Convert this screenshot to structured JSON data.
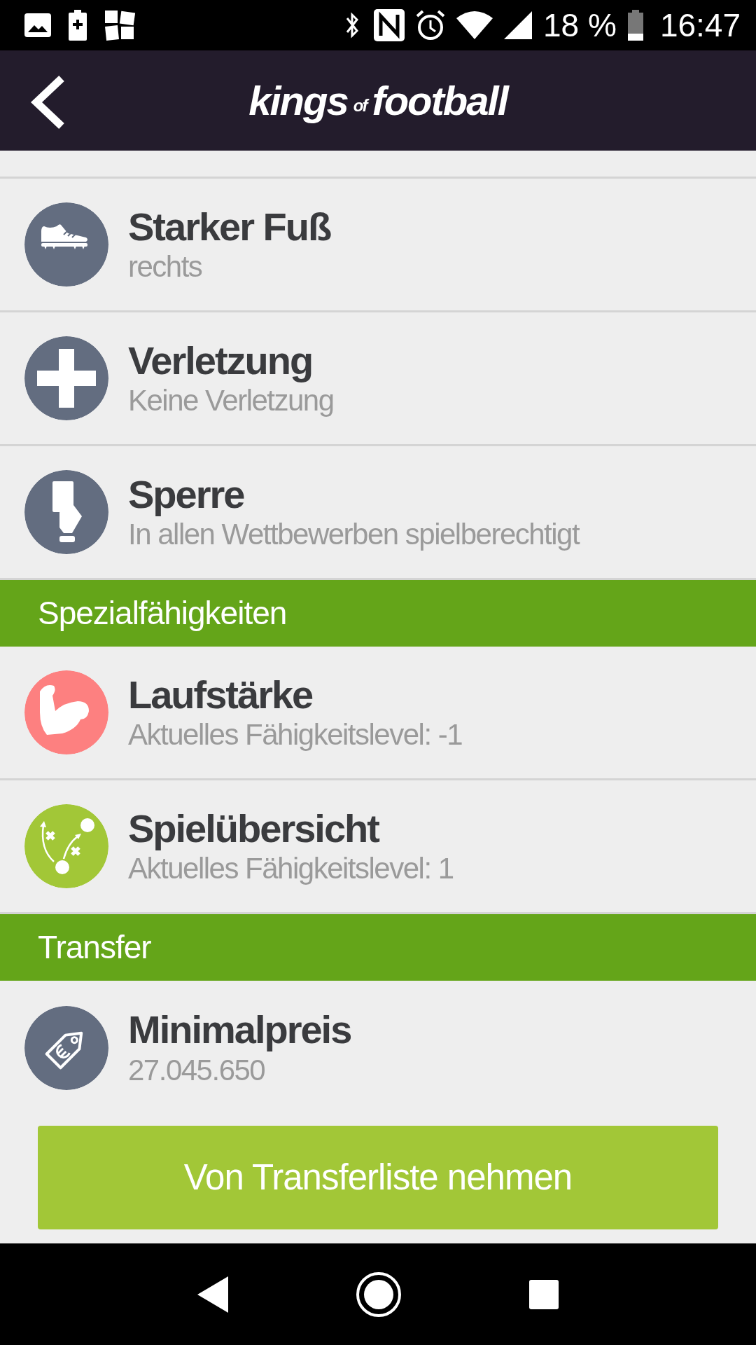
{
  "status_bar": {
    "battery_percent": "18 %",
    "time": "16:47"
  },
  "header": {
    "logo": [
      "kings",
      "of",
      "football"
    ]
  },
  "sections": [
    {
      "items": [
        {
          "kind": "boot",
          "color": "#636d80",
          "title": "Starker Fuß",
          "subtitle": "rechts"
        },
        {
          "kind": "cross",
          "color": "#636d80",
          "title": "Verletzung",
          "subtitle": "Keine Verletzung"
        },
        {
          "kind": "card",
          "color": "#636d80",
          "title": "Sperre",
          "subtitle": "In allen Wettbewerben spielberechtigt"
        }
      ]
    },
    {
      "title": "Spezialfähigkeiten",
      "items": [
        {
          "kind": "muscle",
          "color": "#fd8080",
          "title": "Laufstärke",
          "subtitle": "Aktuelles Fähigkeitslevel: -1"
        },
        {
          "kind": "tactics",
          "color": "#a2c737",
          "title": "Spielübersicht",
          "subtitle": "Aktuelles Fähigkeitslevel: 1"
        }
      ]
    },
    {
      "title": "Transfer",
      "items": [
        {
          "kind": "tag",
          "color": "#636d80",
          "title": "Minimalpreis",
          "subtitle": "27.045.650"
        }
      ]
    }
  ],
  "action_button": "Von Transferliste nehmen"
}
